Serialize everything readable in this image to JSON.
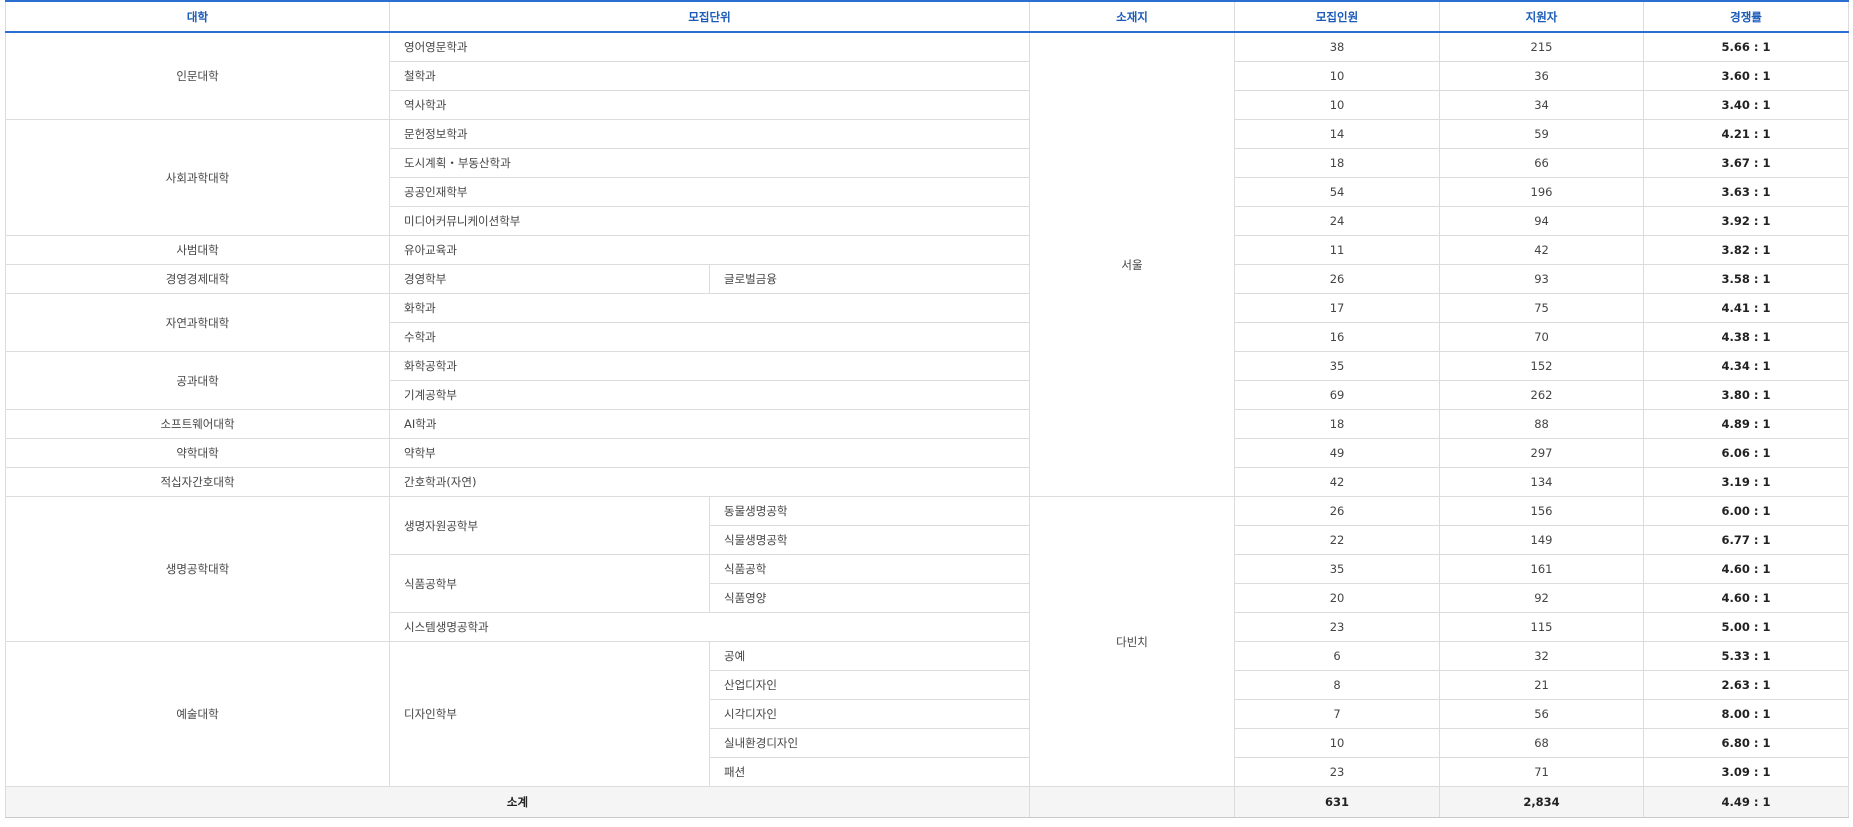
{
  "headers": {
    "college": "대학",
    "unit": "모집단위",
    "location": "소재지",
    "quota": "모집인원",
    "applicants": "지원자",
    "rate": "경쟁률"
  },
  "locations": {
    "seoul": "서울",
    "dabinchi": "다빈치"
  },
  "colleges": {
    "c1": "인문대학",
    "c2": "사회과학대학",
    "c3": "사범대학",
    "c4": "경영경제대학",
    "c5": "자연과학대학",
    "c6": "공과대학",
    "c7": "소프트웨어대학",
    "c8": "약학대학",
    "c9": "적십자간호대학",
    "c10": "생명공학대학",
    "c11": "예술대학"
  },
  "groups": {
    "g1": "생명자원공학부",
    "g2": "식품공학부",
    "g3": "디자인학부"
  },
  "rows": [
    {
      "unit": "영어영문학과",
      "quota": "38",
      "applicants": "215",
      "rate": "5.66 : 1"
    },
    {
      "unit": "철학과",
      "quota": "10",
      "applicants": "36",
      "rate": "3.60 : 1"
    },
    {
      "unit": "역사학과",
      "quota": "10",
      "applicants": "34",
      "rate": "3.40 : 1"
    },
    {
      "unit": "문헌정보학과",
      "quota": "14",
      "applicants": "59",
      "rate": "4.21 : 1"
    },
    {
      "unit": "도시계획・부동산학과",
      "quota": "18",
      "applicants": "66",
      "rate": "3.67 : 1"
    },
    {
      "unit": "공공인재학부",
      "quota": "54",
      "applicants": "196",
      "rate": "3.63 : 1"
    },
    {
      "unit": "미디어커뮤니케이션학부",
      "quota": "24",
      "applicants": "94",
      "rate": "3.92 : 1"
    },
    {
      "unit": "유아교육과",
      "quota": "11",
      "applicants": "42",
      "rate": "3.82 : 1"
    },
    {
      "unit": "경영학부",
      "sub": "글로벌금융",
      "quota": "26",
      "applicants": "93",
      "rate": "3.58 : 1"
    },
    {
      "unit": "화학과",
      "quota": "17",
      "applicants": "75",
      "rate": "4.41 : 1"
    },
    {
      "unit": "수학과",
      "quota": "16",
      "applicants": "70",
      "rate": "4.38 : 1"
    },
    {
      "unit": "화학공학과",
      "quota": "35",
      "applicants": "152",
      "rate": "4.34 : 1"
    },
    {
      "unit": "기계공학부",
      "quota": "69",
      "applicants": "262",
      "rate": "3.80 : 1"
    },
    {
      "unit": "AI학과",
      "quota": "18",
      "applicants": "88",
      "rate": "4.89 : 1"
    },
    {
      "unit": "약학부",
      "quota": "49",
      "applicants": "297",
      "rate": "6.06 : 1"
    },
    {
      "unit": "간호학과(자연)",
      "quota": "42",
      "applicants": "134",
      "rate": "3.19 : 1"
    },
    {
      "sub": "동물생명공학",
      "quota": "26",
      "applicants": "156",
      "rate": "6.00 : 1"
    },
    {
      "sub": "식물생명공학",
      "quota": "22",
      "applicants": "149",
      "rate": "6.77 : 1"
    },
    {
      "sub": "식품공학",
      "quota": "35",
      "applicants": "161",
      "rate": "4.60 : 1"
    },
    {
      "sub": "식품영양",
      "quota": "20",
      "applicants": "92",
      "rate": "4.60 : 1"
    },
    {
      "unit": "시스템생명공학과",
      "quota": "23",
      "applicants": "115",
      "rate": "5.00 : 1"
    },
    {
      "sub": "공예",
      "quota": "6",
      "applicants": "32",
      "rate": "5.33 : 1"
    },
    {
      "sub": "산업디자인",
      "quota": "8",
      "applicants": "21",
      "rate": "2.63 : 1"
    },
    {
      "sub": "시각디자인",
      "quota": "7",
      "applicants": "56",
      "rate": "8.00 : 1"
    },
    {
      "sub": "실내환경디자인",
      "quota": "10",
      "applicants": "68",
      "rate": "6.80 : 1"
    },
    {
      "sub": "패션",
      "quota": "23",
      "applicants": "71",
      "rate": "3.09 : 1"
    }
  ],
  "total": {
    "label": "소계",
    "quota": "631",
    "applicants": "2,834",
    "rate": "4.49 : 1"
  }
}
